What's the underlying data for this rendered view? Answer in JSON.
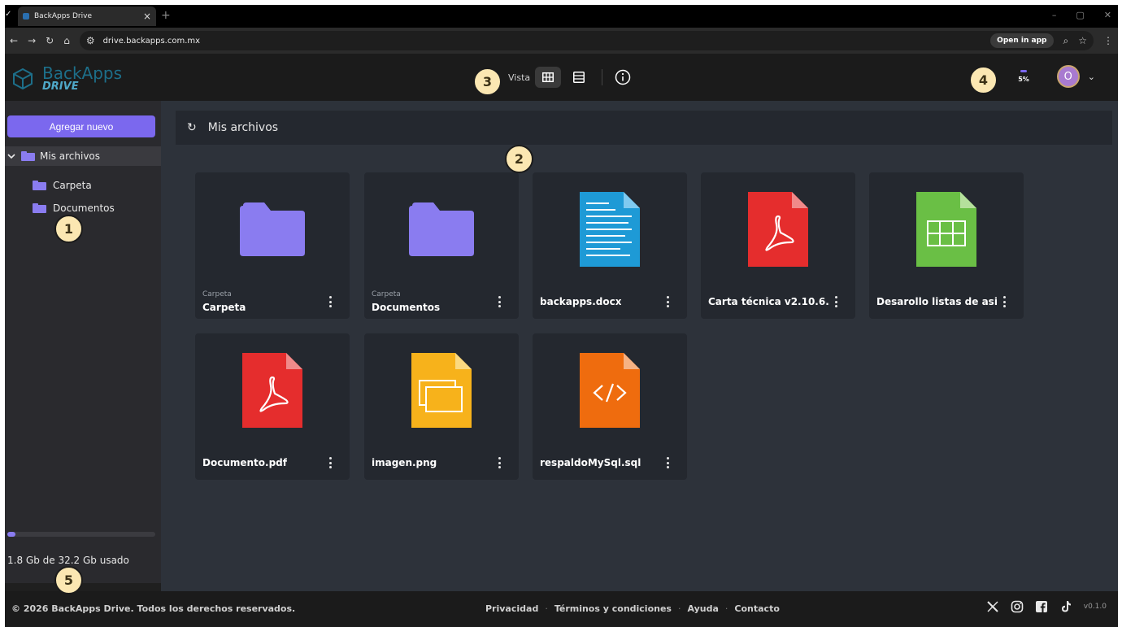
{
  "browser": {
    "tab_title": "BackApps Drive",
    "tab_close": "×",
    "new_tab": "+",
    "url": "drive.backapps.com.mx",
    "open_in_app": "Open in app",
    "win_min": "–",
    "win_restore": "▢",
    "win_close": "✕"
  },
  "header": {
    "logo_line1": "BackApps",
    "logo_line2": "DRIVE",
    "view_label": "Vista",
    "upload_progress": "5%",
    "avatar_initial": "O"
  },
  "sidebar": {
    "add_button": "Agregar nuevo",
    "root": {
      "label": "Mis archivos",
      "expanded": true
    },
    "items": [
      {
        "label": "Carpeta"
      },
      {
        "label": "Documentos"
      }
    ],
    "storage": {
      "used_fraction": 0.056,
      "text": "1.8 Gb de 32.2 Gb usado"
    }
  },
  "main": {
    "path_label": "Mis archivos",
    "files": [
      {
        "type": "folder",
        "subtitle": "Carpeta",
        "name": "Carpeta"
      },
      {
        "type": "folder",
        "subtitle": "Carpeta",
        "name": "Documentos"
      },
      {
        "type": "docx",
        "subtitle": "",
        "name": "backapps.docx"
      },
      {
        "type": "pdf",
        "subtitle": "",
        "name": "Carta técnica v2.10.6...."
      },
      {
        "type": "xlsx",
        "subtitle": "",
        "name": "Desarollo listas de asi..."
      },
      {
        "type": "pdf",
        "subtitle": "",
        "name": "Documento.pdf"
      },
      {
        "type": "image",
        "subtitle": "",
        "name": "imagen.png"
      },
      {
        "type": "code",
        "subtitle": "",
        "name": "respaldoMySql.sql"
      }
    ]
  },
  "footer": {
    "copyright": "© 2026 BackApps Drive. Todos los derechos reservados.",
    "links": [
      "Privacidad",
      "Términos y condiciones",
      "Ayuda",
      "Contacto"
    ],
    "separator": "·",
    "version": "v0.1.0"
  },
  "annotations": [
    "1",
    "2",
    "3",
    "4",
    "5"
  ],
  "colors": {
    "accent": "#7b68ee",
    "folder": "#8a7cf0",
    "docx": "#1e9ad6",
    "pdf": "#e52d2d",
    "xlsx": "#6abf45",
    "image": "#f7b21b",
    "code": "#ef6c0e"
  }
}
